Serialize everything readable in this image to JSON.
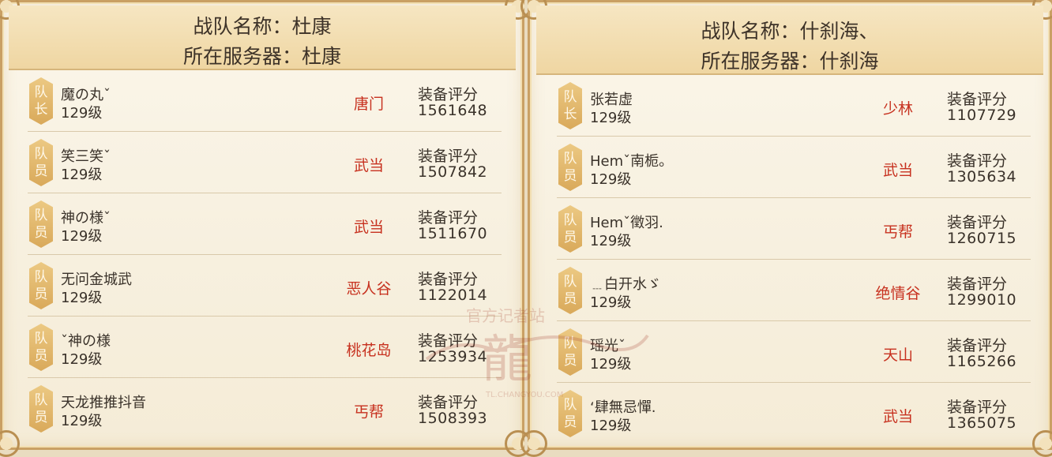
{
  "left_team": {
    "name_label": "战队名称：杜康",
    "server_label": "所在服务器：杜康",
    "members": [
      {
        "role_top": "队",
        "role_bottom": "长",
        "name": "魔の丸ˇ",
        "level": "129级",
        "sect": "唐门",
        "score_label": "装备评分",
        "score": "1561648"
      },
      {
        "role_top": "队",
        "role_bottom": "员",
        "name": "笑三笑ˇ",
        "level": "129级",
        "sect": "武当",
        "score_label": "装备评分",
        "score": "1507842"
      },
      {
        "role_top": "队",
        "role_bottom": "员",
        "name": "神の様ˇ",
        "level": "129级",
        "sect": "武当",
        "score_label": "装备评分",
        "score": "1511670"
      },
      {
        "role_top": "队",
        "role_bottom": "员",
        "name": "无问金城武",
        "level": "129级",
        "sect": "恶人谷",
        "score_label": "装备评分",
        "score": "1122014"
      },
      {
        "role_top": "队",
        "role_bottom": "员",
        "name": "ˇ神の様",
        "level": "129级",
        "sect": "桃花岛",
        "score_label": "装备评分",
        "score": "1253934"
      },
      {
        "role_top": "队",
        "role_bottom": "员",
        "name": "天龙推推抖音",
        "level": "129级",
        "sect": "丐帮",
        "score_label": "装备评分",
        "score": "1508393"
      }
    ]
  },
  "right_team": {
    "name_label": "战队名称：什刹海、",
    "server_label": "所在服务器：什刹海",
    "members": [
      {
        "role_top": "队",
        "role_bottom": "长",
        "name": "张若虚",
        "level": "129级",
        "sect": "少林",
        "score_label": "装备评分",
        "score": "1107729"
      },
      {
        "role_top": "队",
        "role_bottom": "员",
        "name": "Hemˇ南栀。",
        "level": "129级",
        "sect": "武当",
        "score_label": "装备评分",
        "score": "1305634"
      },
      {
        "role_top": "队",
        "role_bottom": "员",
        "name": "Hemˇ徵羽.",
        "level": "129级",
        "sect": "丐帮",
        "score_label": "装备评分",
        "score": "1260715"
      },
      {
        "role_top": "队",
        "role_bottom": "员",
        "name": "﹍白开水ゞ",
        "level": "129级",
        "sect": "绝情谷",
        "score_label": "装备评分",
        "score": "1299010"
      },
      {
        "role_top": "队",
        "role_bottom": "员",
        "name": "瑶光ˇ",
        "level": "129级",
        "sect": "天山",
        "score_label": "装备评分",
        "score": "1165266"
      },
      {
        "role_top": "队",
        "role_bottom": "员",
        "name": "ʻ肆無忌憚.",
        "level": "129级",
        "sect": "武当",
        "score_label": "装备评分",
        "score": "1365075"
      }
    ]
  },
  "watermark": {
    "site_name": "官方记者站",
    "logo_text": "龍",
    "url": "TL.CHANGYOU.COM"
  },
  "colors": {
    "panel_border": "#c9a064",
    "header_bg": "#efd6a2",
    "sect_text": "#c7311f",
    "role_badge": "#d9a95a",
    "body_text": "#3a322a"
  }
}
